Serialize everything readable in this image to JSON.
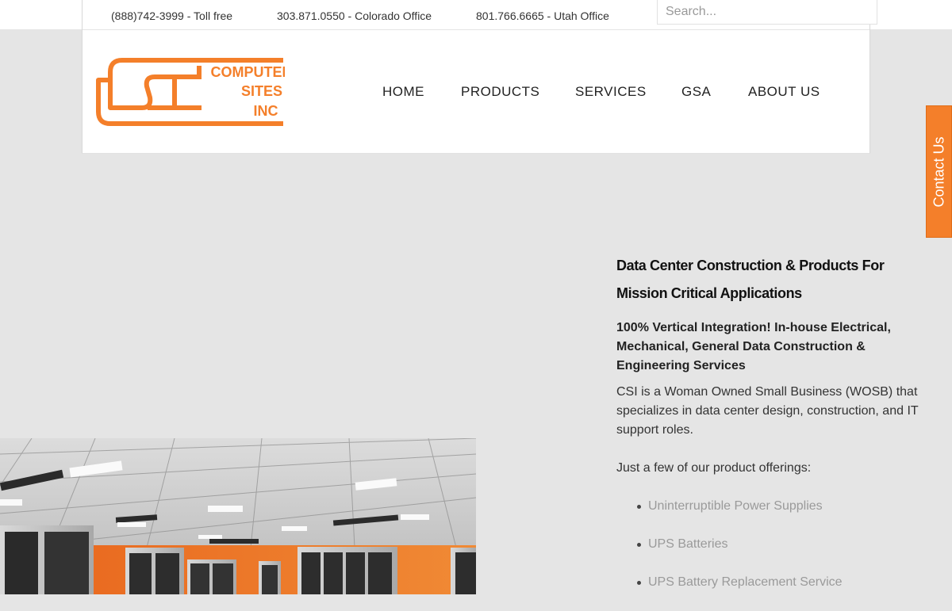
{
  "topbar": {
    "phones": [
      {
        "number": "(888)742-3999",
        "label": " - Toll free"
      },
      {
        "number": "303.871.0550",
        "label": " - Colorado Office"
      },
      {
        "number": "801.766.6665",
        "label": " - Utah Office"
      }
    ],
    "search_placeholder": "Search..."
  },
  "logo": {
    "lines": [
      "COMPUTER",
      "SITES",
      "INC"
    ],
    "color": "#f47f2a"
  },
  "nav": {
    "items": [
      "HOME",
      "PRODUCTS",
      "SERVICES",
      "GSA",
      "ABOUT US"
    ]
  },
  "contact_tab": {
    "label": "Contact Us",
    "color": "#f47f2a"
  },
  "content": {
    "heading": "Data Center Construction & Products For Mission Critical Applications",
    "subheading": "100% Vertical Integration! In-house Electrical, Mechanical, General Data Construction & Engineering Services",
    "intro": "CSI is a Woman Owned Small Business (WOSB) that specializes in data center design, construction, and IT support roles.",
    "offer_intro": "Just a few of our product offerings:",
    "products": [
      "Uninterruptible Power Supplies",
      "UPS Batteries",
      "UPS Battery Replacement Service"
    ]
  }
}
